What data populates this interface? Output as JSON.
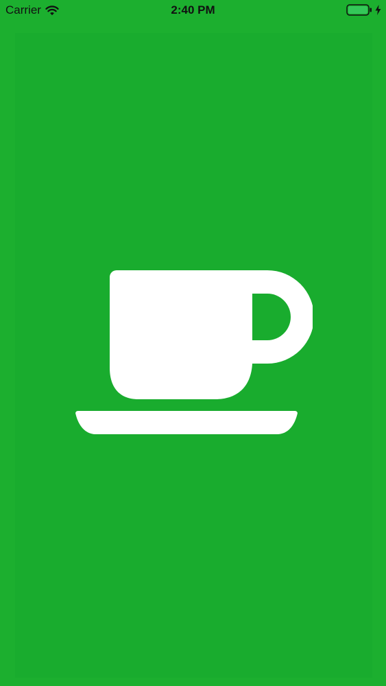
{
  "status_bar": {
    "carrier": "Carrier",
    "time": "2:40 PM",
    "icons": {
      "wifi": "wifi-icon",
      "battery": "battery-icon",
      "charging": "charging-icon"
    }
  },
  "splash": {
    "logo_icon": "coffee-cup-icon"
  },
  "colors": {
    "background": "#1caf2f",
    "panel": "#19ac2e",
    "logo": "#ffffff",
    "status_text": "#111111",
    "battery_fill": "#34c759"
  }
}
